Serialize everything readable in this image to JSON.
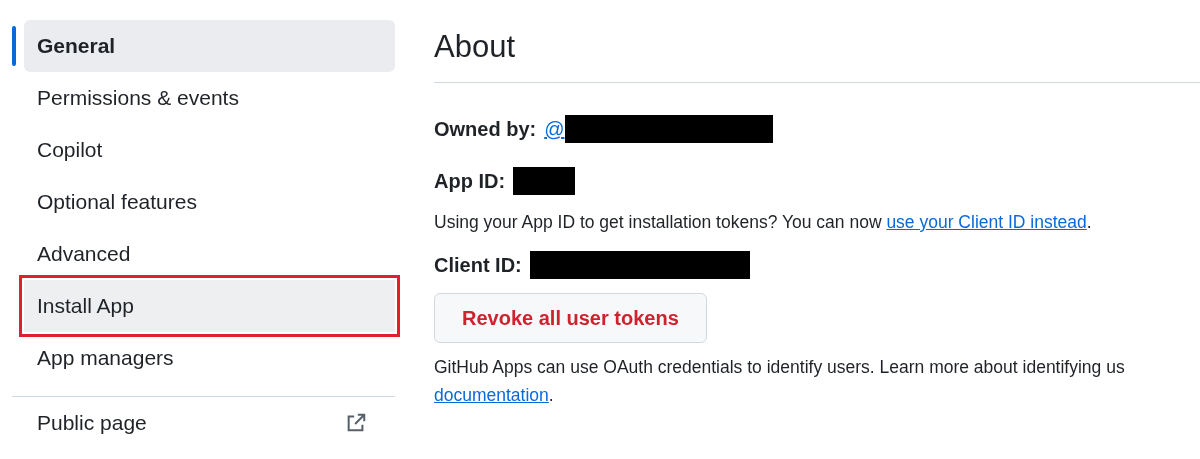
{
  "sidebar": {
    "items": [
      {
        "label": "General",
        "selected": true,
        "highlighted": false
      },
      {
        "label": "Permissions & events",
        "selected": false,
        "highlighted": false
      },
      {
        "label": "Copilot",
        "selected": false,
        "highlighted": false
      },
      {
        "label": "Optional features",
        "selected": false,
        "highlighted": false
      },
      {
        "label": "Advanced",
        "selected": false,
        "highlighted": false
      },
      {
        "label": "Install App",
        "selected": false,
        "highlighted": true
      },
      {
        "label": "App managers",
        "selected": false,
        "highlighted": false
      }
    ],
    "footer_link": {
      "label": "Public page"
    }
  },
  "main": {
    "title": "About",
    "owned_by": {
      "label": "Owned by:",
      "value": "@",
      "redacted": true
    },
    "app_id": {
      "label": "App ID:",
      "redacted": true
    },
    "note": {
      "text": "Using your App ID to get installation tokens? You can now",
      "link": "use your Client ID instead",
      "after": "."
    },
    "client_id": {
      "label": "Client ID:",
      "redacted": true
    },
    "revoke_button": "Revoke all user tokens",
    "oauth_note": {
      "text": "GitHub Apps can use OAuth credentials to identify users. Learn more about identifying us",
      "link": "documentation",
      "after": "."
    }
  }
}
